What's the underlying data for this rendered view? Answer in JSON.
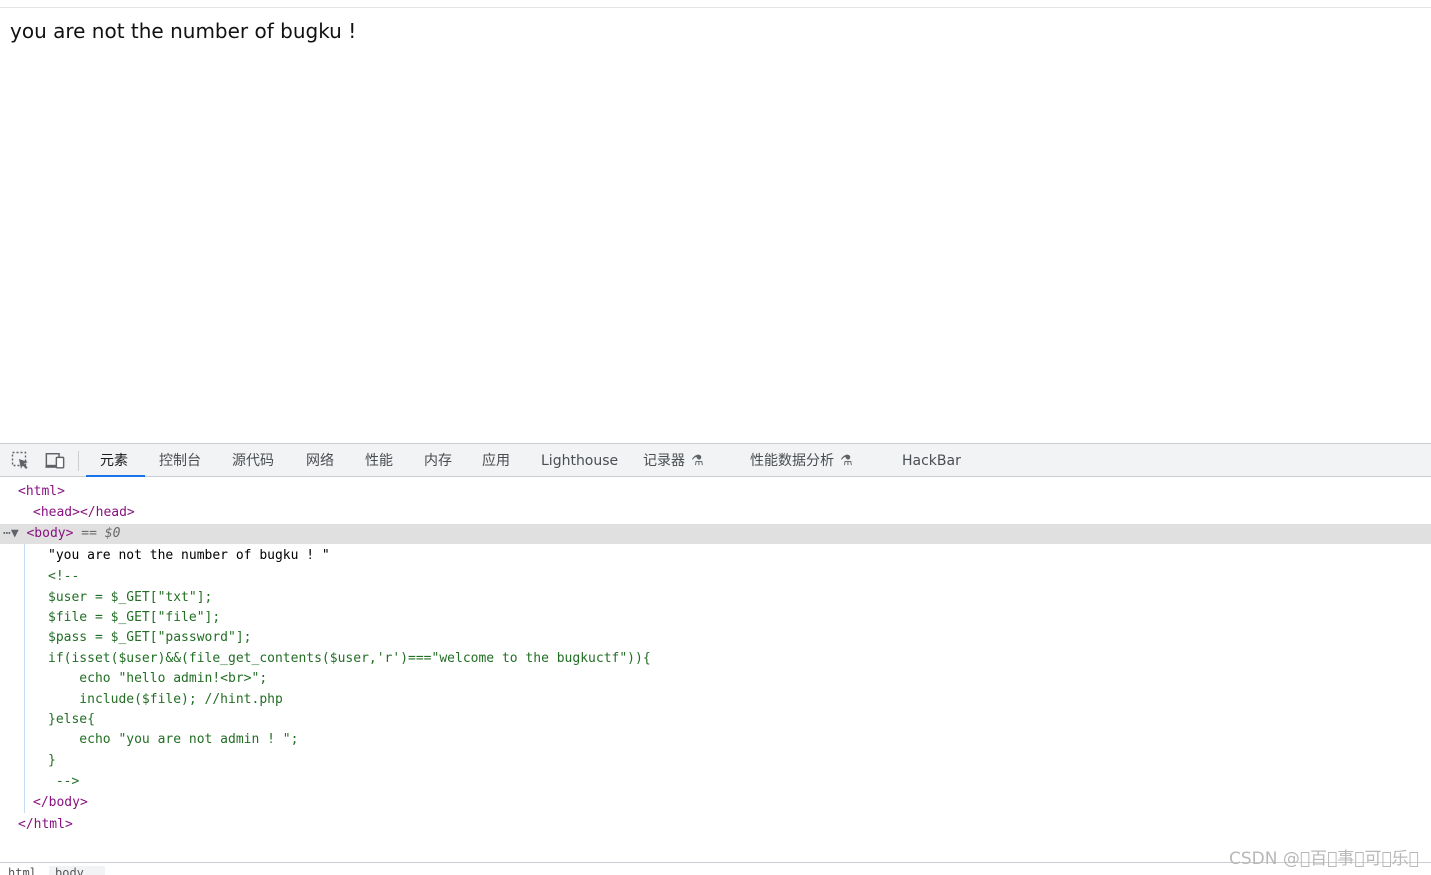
{
  "page": {
    "body_text": "you are not the number of bugku !"
  },
  "devtools": {
    "tabs": [
      {
        "label": "元素",
        "active": true
      },
      {
        "label": "控制台"
      },
      {
        "label": "源代码"
      },
      {
        "label": "网络"
      },
      {
        "label": "性能"
      },
      {
        "label": "内存"
      },
      {
        "label": "应用"
      },
      {
        "label": "Lighthouse"
      },
      {
        "label": "记录器",
        "flask": true
      },
      {
        "label": "性能数据分析",
        "flask": true
      },
      {
        "label": "HackBar"
      }
    ],
    "icons": {
      "inspect": "element-picker-icon",
      "device": "device-toolbar-icon",
      "flask": "experiment-flask-icon"
    },
    "elements": {
      "html_open": "<html>",
      "head": "<head></head>",
      "body_open": "<body>",
      "selected_hint": "== $0",
      "text_node": "\"you are not the number of bugku ! \"",
      "comment_lines": [
        "<!--",
        "$user = $_GET[\"txt\"];",
        "$file = $_GET[\"file\"];",
        "$pass = $_GET[\"password\"];",
        "if(isset($user)&&(file_get_contents($user,'r')===\"welcome to the bugkuctf\")){",
        "    echo \"hello admin!<br>\";",
        "    include($file); //hint.php",
        "}else{",
        "    echo \"you are not admin ! \";",
        "}",
        " -->"
      ],
      "body_close": "</body>",
      "html_close": "</html>"
    },
    "breadcrumbs": [
      "html",
      "body"
    ]
  },
  "watermark": "CSDN @\u0000百\u0000事\u0000可\u0000乐\u0000"
}
